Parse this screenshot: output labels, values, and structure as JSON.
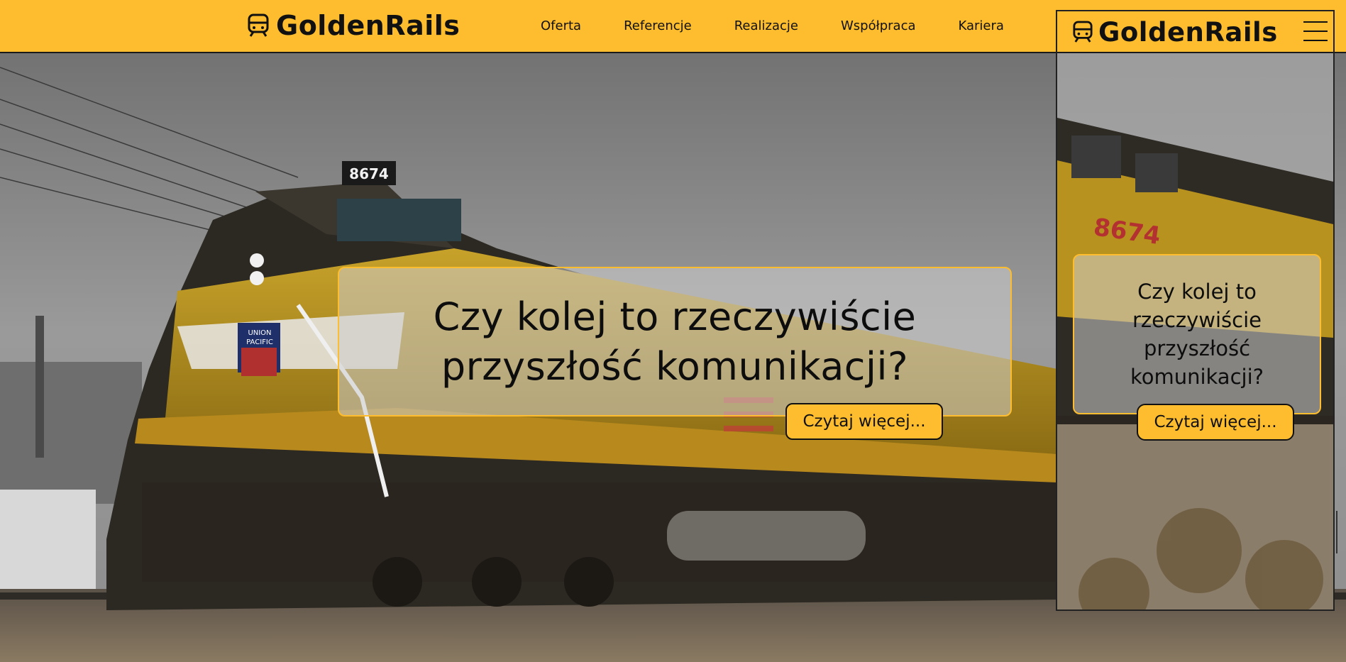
{
  "brand": {
    "name": "GoldenRails",
    "logo_icon": "train-icon"
  },
  "nav": {
    "items": [
      "Oferta",
      "Referencje",
      "Realizacje",
      "Współpraca",
      "Kariera"
    ]
  },
  "hero": {
    "headline_line1": "Czy kolej to rzeczywiście",
    "headline_line2": "przyszłość komunikacji?",
    "cta_label": "Czytaj więcej...",
    "locomotive_number": "8674",
    "locomotive_emblem_line1": "UNION",
    "locomotive_emblem_line2": "PACIFIC"
  },
  "mobile": {
    "brand_name": "GoldenRails",
    "menu_icon": "hamburger-menu-icon",
    "headline": "Czy kolej to rzeczywiście przyszłość komunikacji?",
    "cta_label": "Czytaj więcej...",
    "locomotive_number": "8674"
  },
  "colors": {
    "accent": "#FDBD2E",
    "text": "#111111",
    "card_overlay": "rgba(205,205,205,0.55)"
  }
}
